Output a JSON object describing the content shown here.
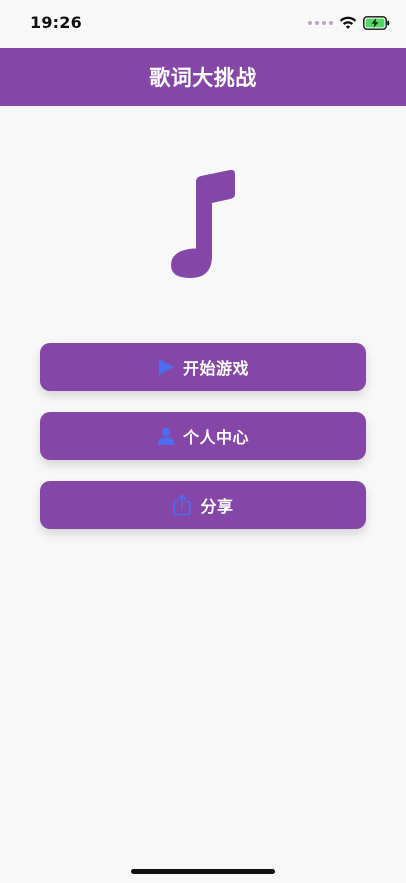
{
  "status_bar": {
    "time": "19:26",
    "wifi_icon": "wifi-icon",
    "battery_icon": "battery-charging-icon",
    "battery_color": "#4cd964"
  },
  "header": {
    "title": "歌词大挑战",
    "background": "#8447a7"
  },
  "logo": {
    "icon": "music-note-icon",
    "color": "#8447a7"
  },
  "menu": {
    "items": [
      {
        "label": "开始游戏",
        "icon": "play-icon"
      },
      {
        "label": "个人中心",
        "icon": "user-icon"
      },
      {
        "label": "分享",
        "icon": "share-icon"
      }
    ]
  },
  "colors": {
    "accent": "#8447a7",
    "icon_blue": "#4f6cf0",
    "background": "#f8f8f8"
  }
}
